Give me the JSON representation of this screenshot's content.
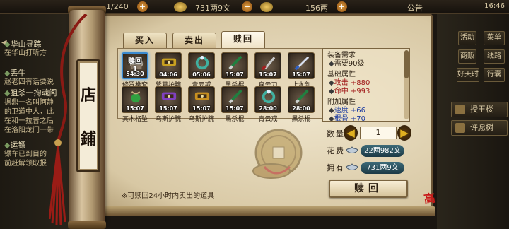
{
  "topbar": {
    "stamina": "1/240",
    "silver": "731两9文",
    "gold": "156两",
    "announcement": "公告",
    "clock": "16:46"
  },
  "quests": [
    {
      "text": "华山寻踪",
      "kind": "title"
    },
    {
      "text": "在华山打听方",
      "kind": "body"
    },
    {
      "text": "丢牛",
      "kind": "title"
    },
    {
      "text": "赵老四有话要说",
      "kind": "body"
    },
    {
      "text": "狙杀一拘魂阁",
      "kind": "title"
    },
    {
      "text": "据鼎一名叫阿静",
      "kind": "body"
    },
    {
      "text": "的卫道中人，此",
      "kind": "body"
    },
    {
      "text": "在和一拉普之后",
      "kind": "body"
    },
    {
      "text": "在洛阳龙门一带",
      "kind": "body"
    },
    {
      "text": "运镖",
      "kind": "title"
    },
    {
      "text": "镖车已到目的",
      "kind": "body"
    },
    {
      "text": "前赶解领取报",
      "kind": "body"
    }
  ],
  "right_menu": {
    "row1": [
      "活动",
      "菜单"
    ],
    "row2": [
      "商贩",
      "线路"
    ],
    "row3": [
      "好天时",
      "行囊"
    ],
    "wide": [
      "授王楼",
      "许愿树"
    ]
  },
  "shop_sign": [
    "店",
    "鋪"
  ],
  "tabs": [
    {
      "label": "买入",
      "active": false
    },
    {
      "label": "卖出",
      "active": false
    },
    {
      "label": "赎回",
      "active": true
    }
  ],
  "items": [
    {
      "name": "修罗拳套",
      "timer": "54:30",
      "redeem_badge": "赎回\n1",
      "selected": true,
      "art": "glove",
      "color": "#d0c8b8"
    },
    {
      "name": "紫葛护腕",
      "timer": "04:06",
      "art": "bracer",
      "color": "#c8a020"
    },
    {
      "name": "青云戒",
      "timer": "05:06",
      "art": "ring",
      "color": "#40b0a0"
    },
    {
      "name": "黑杀棍",
      "timer": "15:07",
      "art": "staff",
      "color": "#208040"
    },
    {
      "name": "穿云刀",
      "timer": "15:07",
      "art": "blade",
      "color": "#a02020"
    },
    {
      "name": "止水剑",
      "timer": "15:07",
      "art": "sword",
      "color": "#3060c0"
    },
    {
      "name": "其木格坠",
      "timer": "15:07",
      "art": "pendant",
      "color": "#30a040"
    },
    {
      "name": "乌斯护腕",
      "timer": "15:07",
      "art": "bracer",
      "color": "#8040c0"
    },
    {
      "name": "乌斯护腕",
      "timer": "15:07",
      "art": "bracer",
      "color": "#c89020"
    },
    {
      "name": "黑杀棍",
      "timer": "15:07",
      "art": "staff",
      "color": "#208040"
    },
    {
      "name": "青云戒",
      "timer": "28:00",
      "art": "ring",
      "color": "#40b0a0"
    },
    {
      "name": "黑杀棍",
      "timer": "28:00",
      "art": "staff",
      "color": "#208040"
    }
  ],
  "info": {
    "req_title": "装备需求",
    "req_level": "需要90级",
    "base_title": "基础属性",
    "attack": "攻击 +880",
    "accuracy": "命中 +993",
    "extra_title": "附加属性",
    "speed": "速度 +66",
    "bone": "根骨 +70"
  },
  "quantity": {
    "label": "数量",
    "value": "1"
  },
  "cost": {
    "label": "花费",
    "value": "22两982文"
  },
  "owned": {
    "label": "拥有",
    "value": "731两9文"
  },
  "redeem_button": "赎回",
  "note": "※可赎回24小时内卖出的道具",
  "watermark": "高手"
}
